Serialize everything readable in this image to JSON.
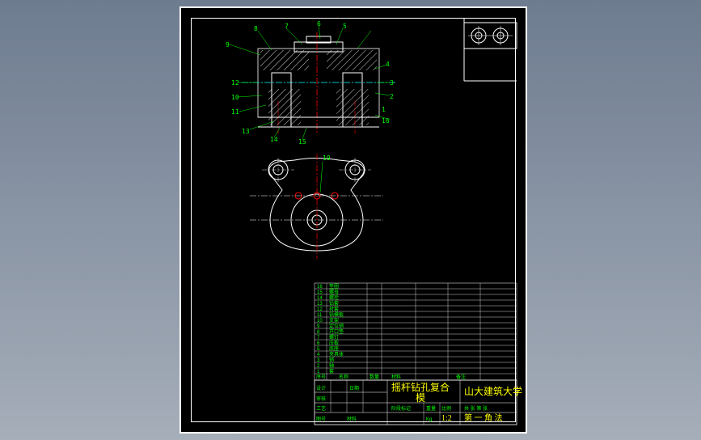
{
  "labels": {
    "n9": "9",
    "n8": "8",
    "n7": "7",
    "n6": "6",
    "n5": "5",
    "n4": "4",
    "n3": "3",
    "n2": "2",
    "n1": "1",
    "n10": "10",
    "n11": "11",
    "n12": "12",
    "n13": "13",
    "n14": "14",
    "n15": "15",
    "n16": "16",
    "n19": "19"
  },
  "bom": {
    "r1": "16",
    "r2": "15",
    "r3": "14",
    "r4": "13",
    "r5": "12",
    "r6": "11",
    "r7": "10",
    "r8": "9",
    "r9": "8",
    "r10": "7",
    "r11": "6",
    "r12": "5",
    "r13": "4",
    "r14": "3",
    "r15": "2",
    "r16": "1",
    "c1": "序号",
    "c2": "名称",
    "c3": "数量",
    "c4": "材料",
    "c5": "备注",
    "d1": "垫圈",
    "d2": "螺母",
    "d3": "螺栓",
    "d4": "钻套",
    "d5": "衬套",
    "d6": "钻模板",
    "d7": "支架",
    "d8": "定位销",
    "d9": "开口垫",
    "d10": "螺钉",
    "d11": "压板",
    "d12": "底座",
    "d13": "夹具体",
    "d14": "销",
    "d15": "轴",
    "d16": "套"
  },
  "title": {
    "main": "摇杆钻孔复合",
    "sub": "模",
    "school": "山大建筑大学",
    "scale_lbl": "比例",
    "scale": "1:2",
    "proj": "第 一 角  法",
    "f1": "设计",
    "f2": "审核",
    "f3": "工艺",
    "f4": "日期",
    "f5": "图号",
    "f6": "共 张 第 张",
    "f7": "阶段标记",
    "f8": "重量",
    "f9": "Kg",
    "f10": "材料"
  }
}
